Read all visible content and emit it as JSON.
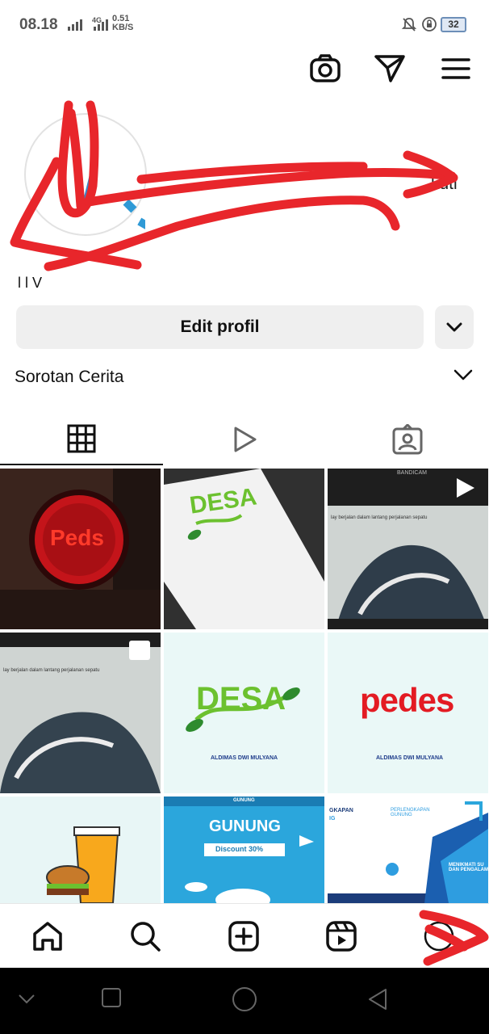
{
  "status_bar": {
    "time": "08.18",
    "network": "4G",
    "speed_value": "0.51",
    "speed_unit": "KB/S",
    "battery": "32",
    "icons": [
      "signal-icon",
      "mute-icon",
      "data-saver-icon",
      "battery-icon"
    ]
  },
  "header": {
    "icons": [
      "camera-icon",
      "direct-message-icon",
      "menu-icon"
    ]
  },
  "profile": {
    "follow_text_fragment": "kuti",
    "name_fragment": "l l V"
  },
  "actions": {
    "edit_profile": "Edit profil",
    "more_icon": "chevron-down-icon"
  },
  "highlights": {
    "label": "Sorotan Cerita"
  },
  "tabs": [
    {
      "icon": "grid-icon",
      "active": true
    },
    {
      "icon": "reels-play-icon",
      "active": false
    },
    {
      "icon": "tagged-icon",
      "active": false
    }
  ],
  "posts": {
    "p1": {
      "text": "Peds"
    },
    "p2": {
      "text": "DESA"
    },
    "p3": {
      "bar": "BANDICAM",
      "caption": "lay berjalan dalam lantang perjalanan sepatu"
    },
    "p4": {
      "caption": "lay berjalan dalam lantang perjalanan sepatu"
    },
    "p5": {
      "logo": "DESA",
      "caption": "ALDIMAS DWI MULYANA"
    },
    "p6": {
      "logo": "pedes",
      "caption": "ALDIMAS DWI MULYANA"
    },
    "p8": {
      "small": "GUNUNG",
      "title": "GUNUNG",
      "badge": "Discount 30%"
    },
    "p9": {
      "left_title": "GKAPAN",
      "left_sub": "IG",
      "right_title": "PERLENGKAPAN GUNUNG",
      "tagline": "MENIKMATI SU DAN PENGALAM"
    }
  },
  "bottom_nav": [
    "home-icon",
    "search-icon",
    "create-icon",
    "reels-icon",
    "profile-avatar"
  ],
  "colors": {
    "scribble": "#e8262b",
    "button_bg": "#efefef",
    "accent_green": "#6cc12f",
    "accent_red": "#e31b23",
    "promo_blue": "#2ba6dc"
  }
}
